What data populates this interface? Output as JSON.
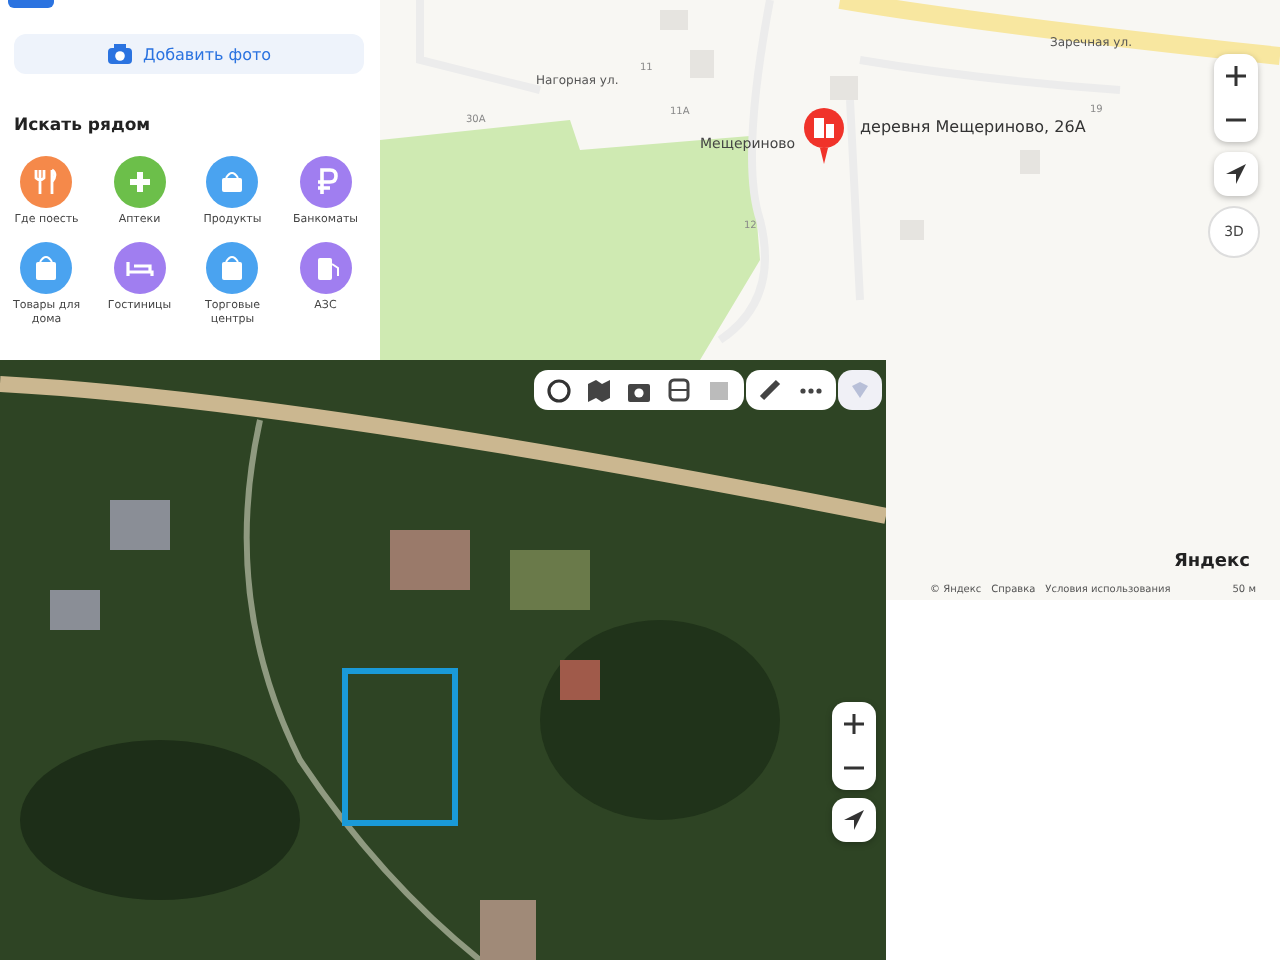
{
  "place_panel": {
    "add_photo": "Добавить фото",
    "nearby_title": "Искать рядом",
    "categories": [
      {
        "label": "Где поесть",
        "color": "#f5894a"
      },
      {
        "label": "Аптеки",
        "color": "#6cbf4a"
      },
      {
        "label": "Продукты",
        "color": "#4aa3f0"
      },
      {
        "label": "Банкоматы",
        "color": "#a07ef0"
      },
      {
        "label": "Товары для дома",
        "color": "#4aa3f0"
      },
      {
        "label": "Гостиницы",
        "color": "#a07ef0"
      },
      {
        "label": "Торговые центры",
        "color": "#4aa3f0"
      },
      {
        "label": "АЗС",
        "color": "#a07ef0"
      }
    ]
  },
  "map": {
    "streets": [
      {
        "label": "Нагорная ул.",
        "kind": "street"
      },
      {
        "label": "Заречная ул.",
        "kind": "street"
      },
      {
        "label": "Мещериново",
        "kind": "village"
      }
    ],
    "house_numbers": [
      "30А",
      "11",
      "11А",
      "12",
      "19"
    ],
    "pin_label": "деревня Мещериново, 26А",
    "view_3d": "3D",
    "logo": "Яндекс",
    "footer": [
      "© Яндекс",
      "Справка",
      "Условия использования"
    ],
    "scale": "50 м"
  }
}
